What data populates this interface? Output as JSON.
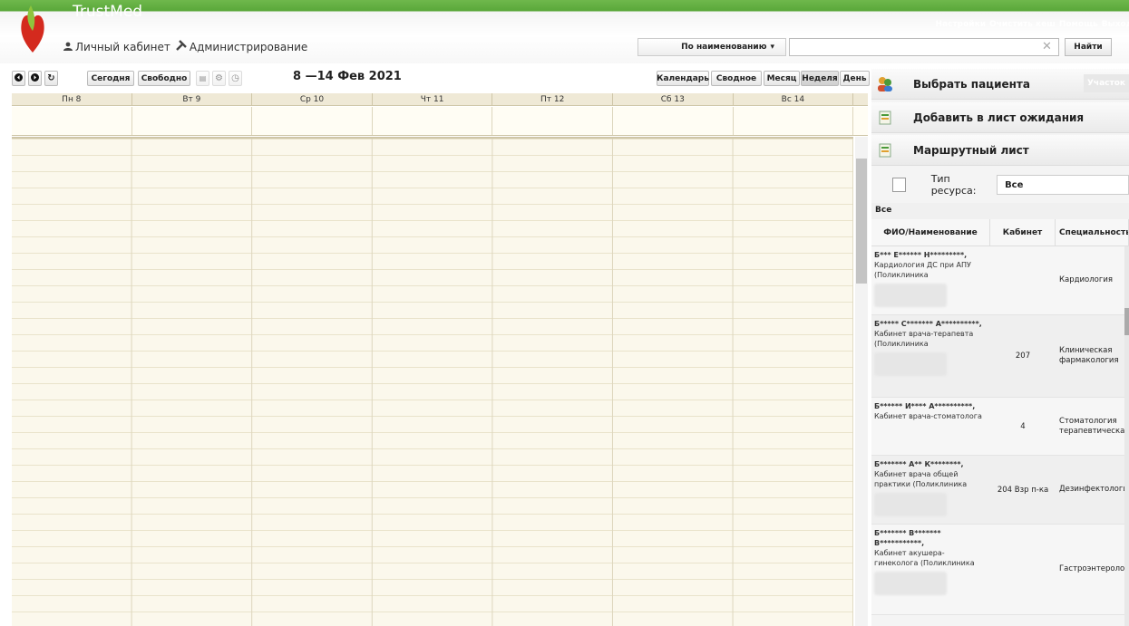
{
  "header": {
    "brand": "TrustMed",
    "nav": {
      "cabinet": "Личный кабинет",
      "admin": "Администрирование"
    },
    "top_links": [
      "Настройки",
      "Очистить кеш",
      "Помощь",
      "Выход"
    ],
    "search_mode": "По наименованию",
    "search_placeholder": "",
    "search_button": "Найти"
  },
  "toolbar": {
    "today": "Сегодня",
    "free": "Свободно",
    "date_range": "8 —14 Фев 2021",
    "views": [
      "Календарь",
      "Сводное",
      "Месяц",
      "Неделя",
      "День"
    ],
    "active_view": "Неделя"
  },
  "calendar": {
    "days": [
      "Пн 8",
      "Вт 9",
      "Ср 10",
      "Чт 11",
      "Пт 12",
      "Сб 13",
      "Вс 14"
    ]
  },
  "panel": {
    "select_patient": "Выбрать пациента",
    "uchastok": "Участок",
    "waitlist": "Добавить в лист ожидания",
    "route": "Маршрутный лист",
    "resource_type_label": "Тип ресурса:",
    "resource_type_value": "Все",
    "group": "Все",
    "columns": [
      "ФИО/Наименование",
      "Кабинет",
      "Специальность"
    ],
    "rows": [
      {
        "name": "Б*** Е****** Н*********,",
        "dept": "Кардиология ДС при АПУ (Поликлиника",
        "room": "",
        "spec": "Кардиология"
      },
      {
        "name": "Б***** С******* А**********,",
        "dept": "Кабинет врача-терапевта (Поликлиника",
        "room": "207",
        "spec": "Клиническая фармакология"
      },
      {
        "name": "Б****** И**** А**********,",
        "dept": "Кабинет врача-стоматолога",
        "room": "4",
        "spec": "Стоматология терапевтическая"
      },
      {
        "name": "Б******* А** К********,",
        "dept": "Кабинет врача общей практики (Поликлиника",
        "room": "204 Взр п-ка",
        "spec": "Дезинфектология"
      },
      {
        "name": "Б******* В******* В***********,",
        "dept": "Кабинет акушера-гинеколога (Поликлиника",
        "room": "",
        "spec": "Гастроэнтерология"
      }
    ]
  },
  "colors": {
    "brand_green": "#5aa83a",
    "calendar_bg": "#fbf8ec"
  }
}
